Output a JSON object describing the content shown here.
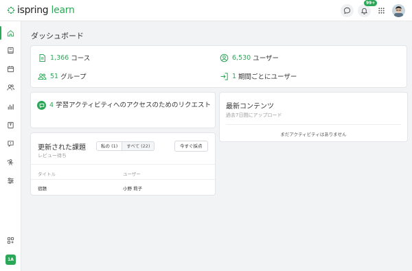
{
  "app": {
    "brand_first": "ispring",
    "brand_second": "learn",
    "notification_badge": "99+"
  },
  "sidebar": {
    "user_initials": "1A"
  },
  "dashboard": {
    "title": "ダッシュボード",
    "stats": {
      "courses": {
        "num": "1,366",
        "label": "コース"
      },
      "users": {
        "num": "6,530",
        "label": "ユーザー"
      },
      "groups": {
        "num": "51",
        "label": "グループ"
      },
      "per_user": {
        "num": "1",
        "label": "期間ごとにユーザー"
      }
    },
    "requests": {
      "num": "4",
      "text": "学習アクティビティへのアクセスのためのリクエスト"
    },
    "latest": {
      "title": "最新コンテンツ",
      "subtitle": "過去7日間にアップロード",
      "empty": "まだアクティビティはありません"
    },
    "assignments": {
      "title": "更新された課題",
      "subtitle": "レビュー待ち",
      "filter_mine": "私の (1)",
      "filter_all": "すべて (22)",
      "grade_button": "今すぐ採点",
      "columns": [
        "タイトル",
        "ユーザー"
      ],
      "rows": [
        {
          "title": "宿題",
          "user": "小野 莉子"
        }
      ]
    }
  },
  "colors": {
    "accent": "#2aa857",
    "background": "#f2f3f4"
  },
  "icons": [
    "home-icon",
    "book-icon",
    "calendar-icon",
    "users-icon",
    "chart-icon",
    "certificate-icon",
    "chat-icon",
    "coach-icon",
    "settings-sliders-icon",
    "apps-add-icon",
    "chat-bubble-icon",
    "bell-icon",
    "grid-icon"
  ]
}
